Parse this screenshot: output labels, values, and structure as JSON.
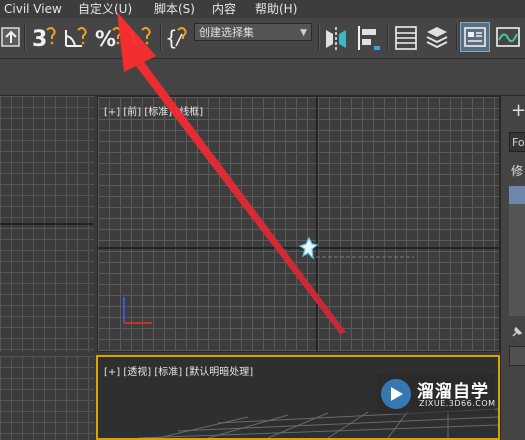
{
  "menubar": {
    "items": [
      {
        "label": "Civil View"
      },
      {
        "label": "自定义(U)"
      },
      {
        "label": "脚本(S)"
      },
      {
        "label": "内容"
      },
      {
        "label": "帮助(H)"
      }
    ]
  },
  "toolbar": {
    "selection_set": {
      "value": "创建选择集"
    }
  },
  "viewports": {
    "front": {
      "label": "[+] [前] [标准] [线框]"
    },
    "perspective": {
      "label": "[+] [透视] [标准] [默认明暗处理]"
    }
  },
  "command_panel": {
    "field_text": "Fo",
    "modifier_label": "修"
  },
  "watermark": {
    "brand": "溜溜自学",
    "url": "ZIXUE.3D66.COM"
  },
  "colors": {
    "annotation_arrow": "#e8323a",
    "active_viewport_border": "#d9a400",
    "accent_blue": "#4a90d9"
  }
}
